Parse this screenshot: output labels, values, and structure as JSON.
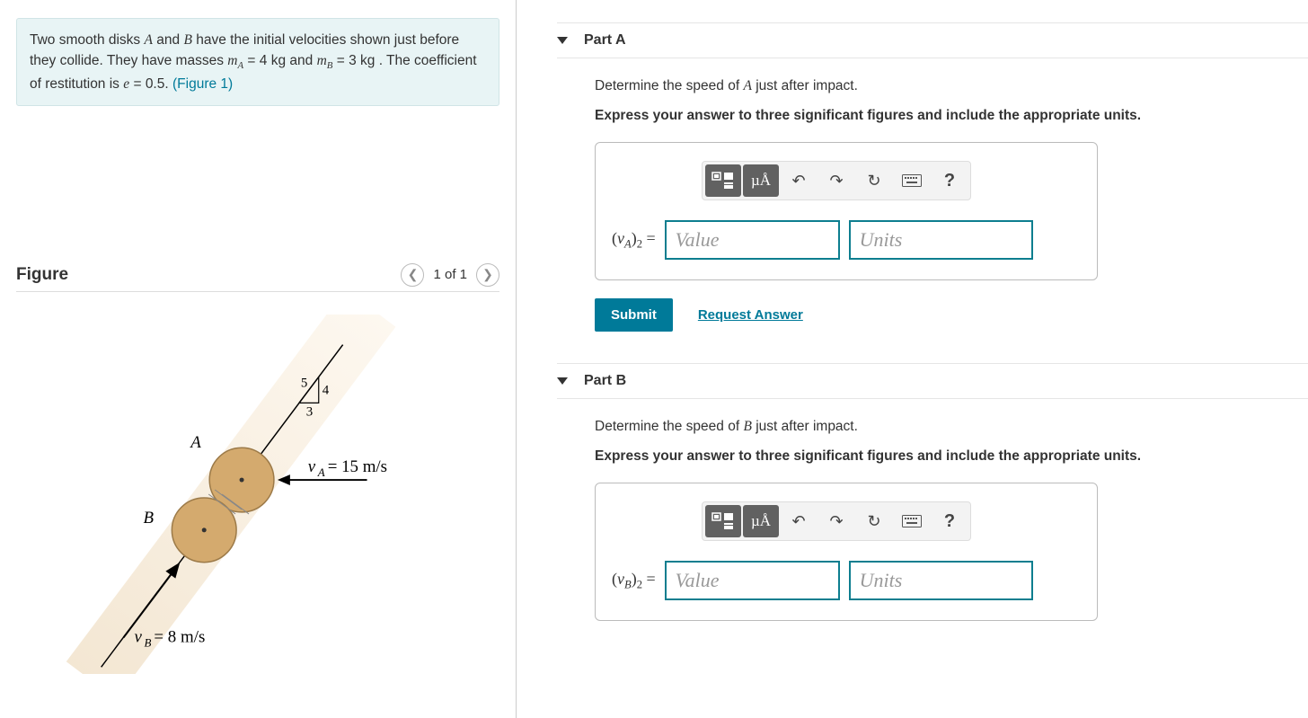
{
  "problem": {
    "text_pre": "Two smooth disks ",
    "A": "A",
    "and": " and ",
    "B": "B",
    "text_mid1": " have the initial velocities shown just before they collide. They have masses ",
    "mA_label": "m",
    "mA_sub": "A",
    "mA_eq": " = ",
    "mA_val": "4",
    "mA_unit": " kg",
    "and2": " and ",
    "mB_label": "m",
    "mB_sub": "B",
    "mB_eq": " = ",
    "mB_val": "3",
    "mB_unit": " kg",
    "text_mid2": " . The coefficient of restitution is ",
    "e_label": "e",
    "e_eq": " = ",
    "e_val": "0.5",
    "period": ". ",
    "fig_link": "(Figure 1)"
  },
  "figure": {
    "title": "Figure",
    "counter": "1 of 1",
    "tri": {
      "hyp": "5",
      "opp": "4",
      "adj": "3"
    },
    "diskA": "A",
    "diskB": "B",
    "vA_label": "v",
    "vA_sub": "A",
    "vA_eq": " = 15 m/s",
    "vB_label": "v",
    "vB_sub": "B",
    "vB_eq": " = 8 m/s"
  },
  "partA": {
    "title": "Part A",
    "q_pre": "Determine the speed of ",
    "q_var": "A",
    "q_post": " just after impact.",
    "bold": "Express your answer to three significant figures and include the appropriate units.",
    "label_pre": "(",
    "label_v": "v",
    "label_sub": "A",
    "label_post": ")",
    "label_idx": "2",
    "label_eq": " = ",
    "value_ph": "Value",
    "units_ph": "Units",
    "submit": "Submit",
    "request": "Request Answer",
    "mu": "µÅ"
  },
  "partB": {
    "title": "Part B",
    "q_pre": "Determine the speed of ",
    "q_var": "B",
    "q_post": " just after impact.",
    "bold": "Express your answer to three significant figures and include the appropriate units.",
    "label_pre": "(",
    "label_v": "v",
    "label_sub": "B",
    "label_post": ")",
    "label_idx": "2",
    "label_eq": " = ",
    "value_ph": "Value",
    "units_ph": "Units",
    "mu": "µÅ"
  }
}
